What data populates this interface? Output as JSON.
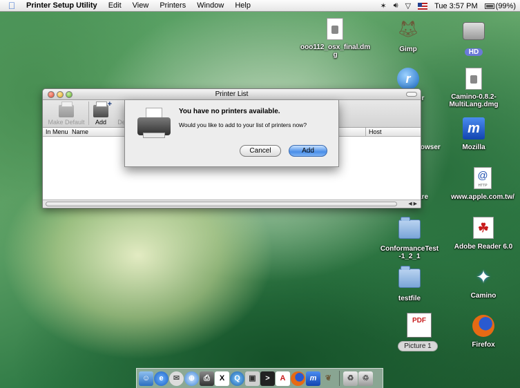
{
  "menubar": {
    "app_name": "Printer Setup Utility",
    "items": [
      "Edit",
      "View",
      "Printers",
      "Window",
      "Help"
    ],
    "clock": "Tue 3:57 PM",
    "battery": "(99%)"
  },
  "desktop_icons": {
    "ooo": "ooo112_osx_final.dm\ng",
    "gimp": "Gimp",
    "hd": "HD",
    "camino_dmg": "Camino-0.8.2-\nMultiLang.dmg",
    "partial1": "er",
    "partial2": "rowser",
    "mozilla": "Mozilla",
    "apple_site": "www.apple.com.tw/",
    "partial3": "are",
    "conformance": "ConformanceTest\n-1_2_1",
    "adobe_reader": "Adobe Reader 6.0",
    "testfile": "testfile",
    "camino": "Camino",
    "picture": "Picture 1",
    "firefox": "Firefox"
  },
  "window": {
    "title": "Printer List",
    "toolbar": {
      "make_default": "Make Default",
      "add": "Add",
      "delete_partial": "De"
    },
    "columns": {
      "in_menu": "In Menu",
      "name": "Name",
      "host": "Host"
    }
  },
  "sheet": {
    "title": "You have no printers available.",
    "message": "Would you like to add to your list of printers now?",
    "cancel_label": "Cancel",
    "add_label": "Add"
  },
  "colors": {
    "accent_button": "#4a8ee8",
    "hd_label_bg": "#6b79d8"
  },
  "dock": {
    "items": [
      "finder-icon",
      "ie-icon",
      "mail-icon",
      "safari-icon",
      "printer-icon",
      "x11-icon",
      "quicktime-icon",
      "preview-icon",
      "terminal-icon",
      "adobe-icon",
      "firefox-icon",
      "mozilla-icon",
      "gimp-icon",
      "trash-icon",
      "trash-full-icon"
    ]
  }
}
